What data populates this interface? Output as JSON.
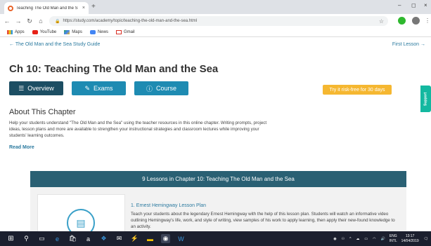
{
  "browser": {
    "tab_title": "Teaching The Old Man and the S",
    "tab_close": "×",
    "new_tab": "+",
    "window_controls": [
      "–",
      "◻",
      "×"
    ],
    "url": "https://study.com/academy/topic/teaching-the-old-man-and-the-sea.html",
    "bookmarks": [
      "Apps",
      "YouTube",
      "Maps",
      "News",
      "Gmail"
    ]
  },
  "page": {
    "crumb_left": "← The Old Man and the Sea Study Guide",
    "crumb_right": "First Lesson →",
    "chapter_prefix": "Ch 10:",
    "chapter_title": "Teaching The Old Man and the Sea",
    "tabs": [
      "Overview",
      "Exams",
      "Course"
    ],
    "try_button": "Try it risk-free for 30 days",
    "support": "Support",
    "about_heading": "About This Chapter",
    "about_text": "Help your students understand \"The Old Man and the Sea\" using the teacher resources in this online chapter. Writing prompts, project ideas, lesson plans and more are available to strengthen your instructional strategies and classroom lectures while improving your students' learning outcomes.",
    "read_more": "Read More",
    "lessons_header": "9 Lessons in Chapter 10: Teaching The Old Man and the Sea",
    "lesson1_title": "1. Ernest Hemingway Lesson Plan",
    "lesson1_desc": "Teach your students about the legendary Ernest Hemingway with the help of this lesson plan. Students will watch an informative video outlining Hemingway's life, work, and style of writing, view samples of his work to apply learning, then apply their new-found knowledge to an activity."
  },
  "taskbar": {
    "lang": "ENG",
    "region": "INTL",
    "time": "13:17",
    "date": "14/04/2019"
  },
  "colors": {
    "accent": "#1e8bb2",
    "dark_tab": "#1c4e63",
    "try": "#f5b731",
    "support": "#13b8a0",
    "lessons_header": "#2a6073"
  }
}
